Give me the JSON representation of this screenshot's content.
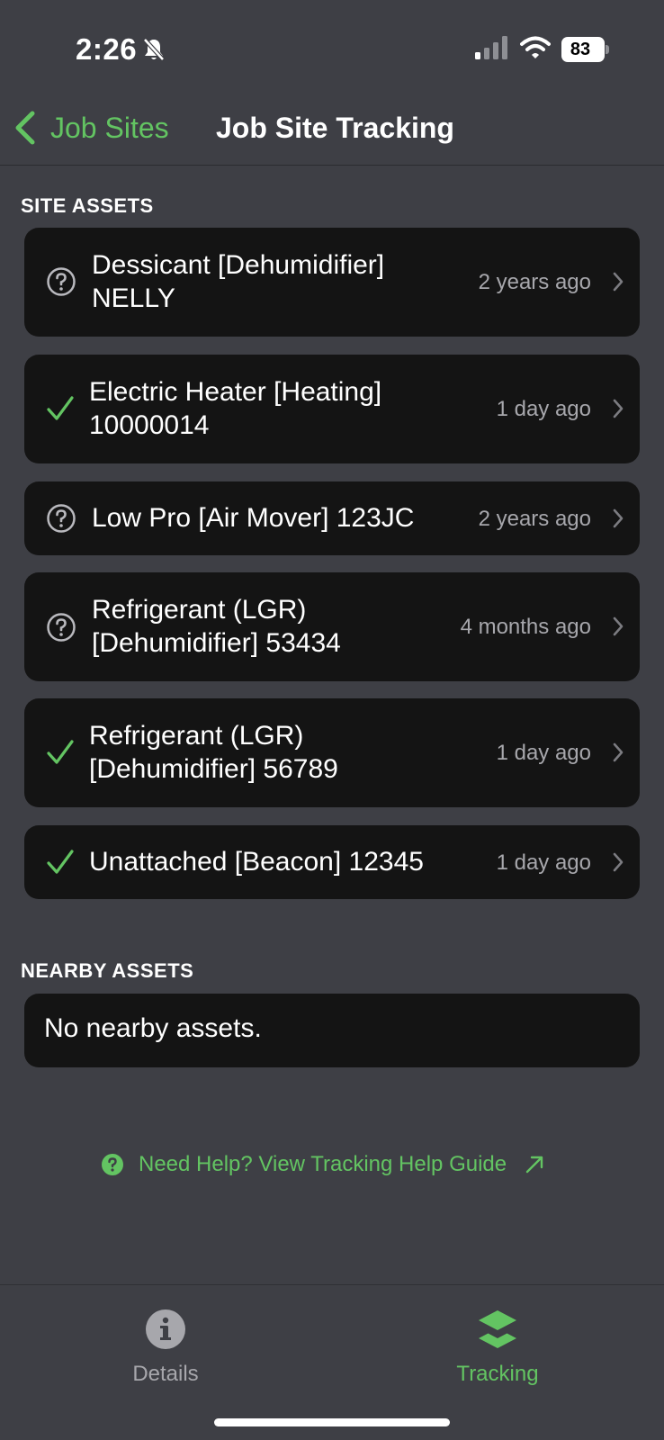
{
  "status_bar": {
    "time": "2:26",
    "battery": "83"
  },
  "nav": {
    "back_label": "Job Sites",
    "title": "Job Site Tracking"
  },
  "site_assets": {
    "header": "SITE ASSETS",
    "items": [
      {
        "title": "Dessicant [Dehumidifier] NELLY",
        "ago": "2 years ago",
        "status": "unknown"
      },
      {
        "title": "Electric Heater [Heating] 10000014",
        "ago": "1 day ago",
        "status": "ok"
      },
      {
        "title": "Low Pro [Air Mover] 123JC",
        "ago": "2 years ago",
        "status": "unknown"
      },
      {
        "title": "Refrigerant (LGR) [Dehumidifier] 53434",
        "ago": "4 months ago",
        "status": "unknown"
      },
      {
        "title": "Refrigerant (LGR) [Dehumidifier] 56789",
        "ago": "1 day ago",
        "status": "ok"
      },
      {
        "title": "Unattached [Beacon] 12345",
        "ago": "1 day ago",
        "status": "ok"
      }
    ]
  },
  "nearby_assets": {
    "header": "NEARBY ASSETS",
    "empty_message": "No nearby assets."
  },
  "help": {
    "label": "Need Help? View Tracking Help Guide"
  },
  "tabs": [
    {
      "label": "Details",
      "icon": "info-icon",
      "active": false
    },
    {
      "label": "Tracking",
      "icon": "layers-icon",
      "active": true
    }
  ],
  "colors": {
    "accent": "#63c462",
    "background": "#3e3f45",
    "card": "#141414",
    "muted": "#a7a7ac"
  }
}
